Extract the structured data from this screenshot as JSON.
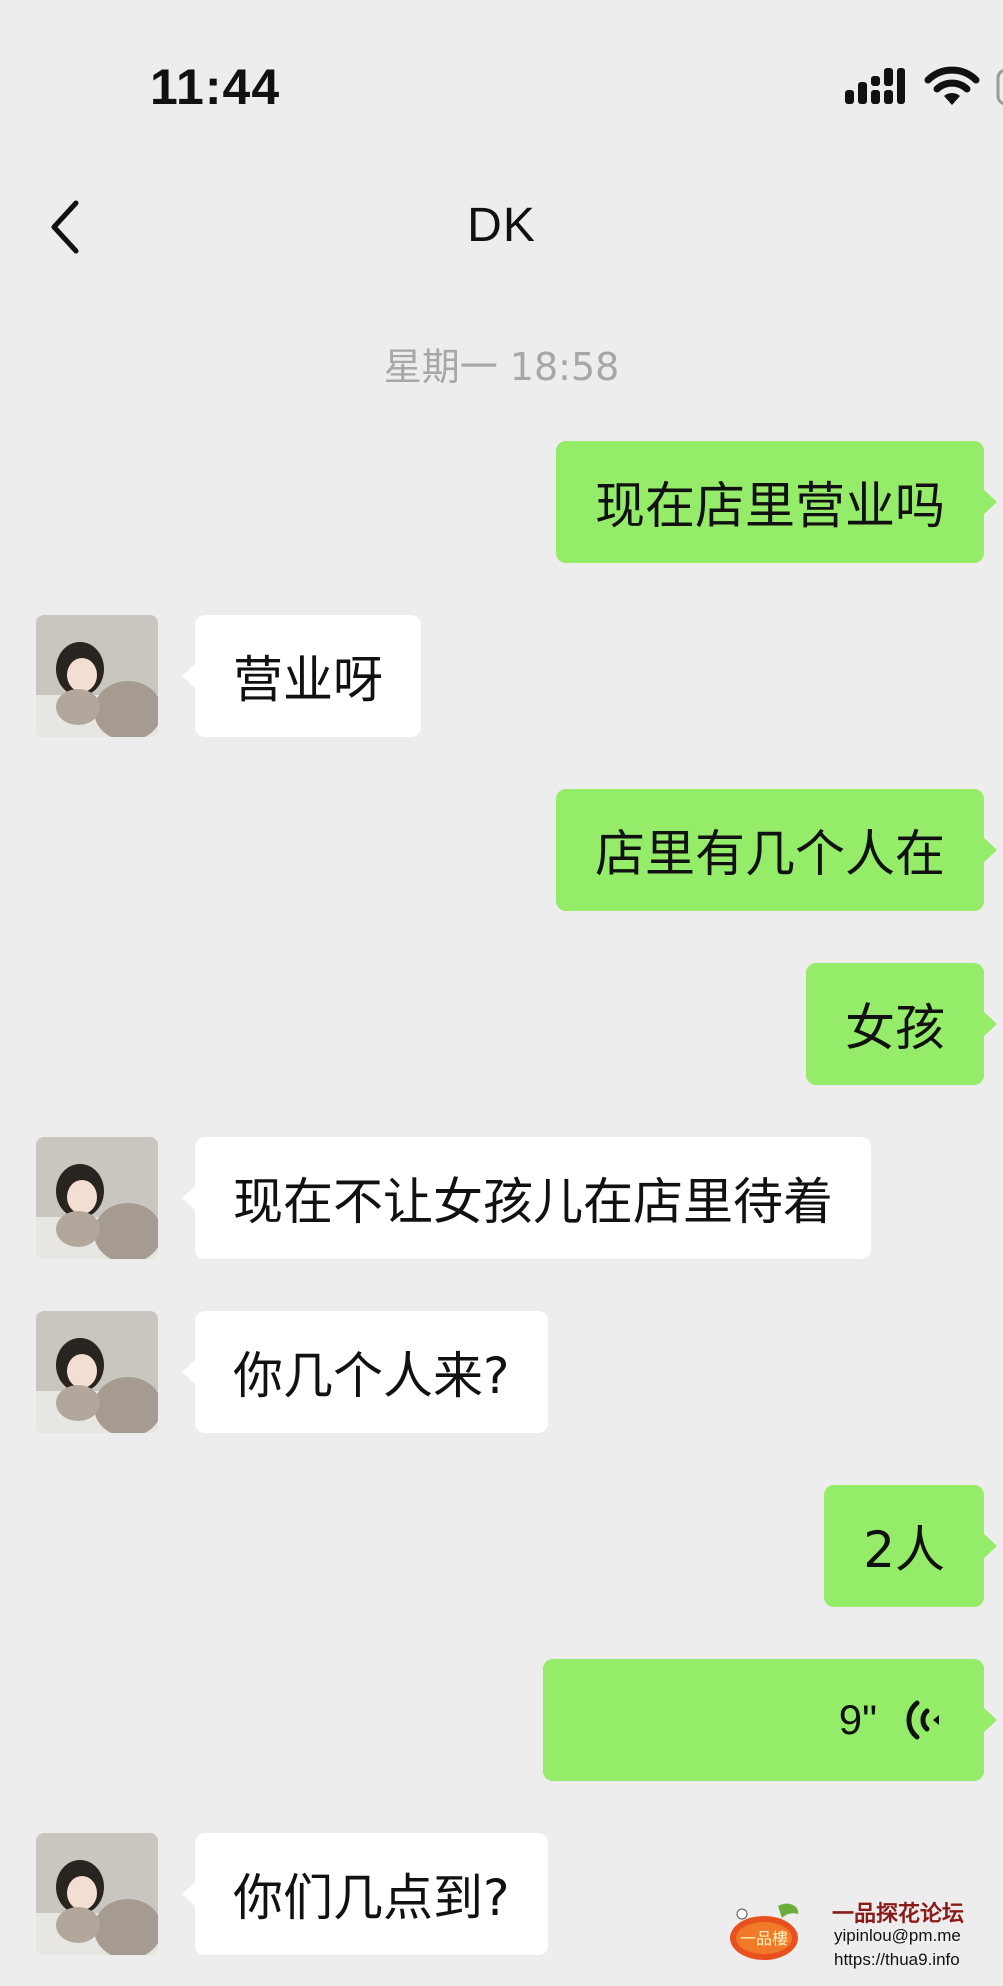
{
  "status_bar": {
    "time": "11:44",
    "icons": [
      "signal-icon",
      "wifi-icon",
      "battery-icon"
    ]
  },
  "nav": {
    "back_icon": "chevron-left-icon",
    "title": "DK"
  },
  "timestamp": "星期一 18:58",
  "colors": {
    "background": "#EDEDED",
    "outgoing_bubble": "#95EC69",
    "incoming_bubble": "#FFFFFF",
    "timestamp_text": "#A7A7A7"
  },
  "messages": [
    {
      "direction": "out",
      "type": "text",
      "text": "现在店里营业吗"
    },
    {
      "direction": "in",
      "type": "text",
      "text": "营业呀"
    },
    {
      "direction": "out",
      "type": "text",
      "text": "店里有几个人在"
    },
    {
      "direction": "out",
      "type": "text",
      "text": "女孩"
    },
    {
      "direction": "in",
      "type": "text",
      "text": "现在不让女孩儿在店里待着"
    },
    {
      "direction": "in",
      "type": "text",
      "text": "你几个人来?"
    },
    {
      "direction": "out",
      "type": "text",
      "text": "2人"
    },
    {
      "direction": "out",
      "type": "voice",
      "duration": "9\"",
      "icon": "voice-wave-icon"
    },
    {
      "direction": "in",
      "type": "text",
      "text": "你们几点到?"
    }
  ],
  "watermark": {
    "title": "一品探花论坛",
    "email": "yipinlou@pm.me",
    "url": "https://thua9.info",
    "logo_text": "一品楼"
  }
}
